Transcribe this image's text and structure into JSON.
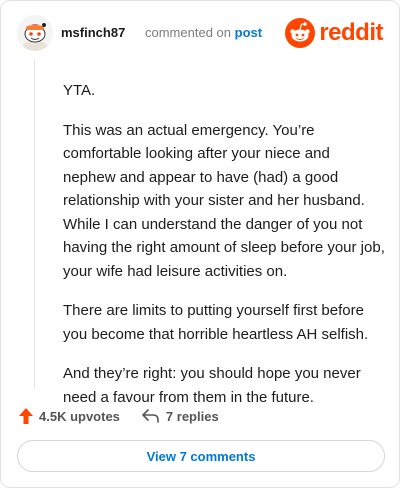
{
  "header": {
    "username": "msfinch87",
    "commented_on": "commented on",
    "post_link": "post",
    "logo_wordmark": "reddit",
    "brand_color": "#ff4500",
    "avatar_icon": "snoo-avatar-icon"
  },
  "comment": {
    "paragraphs": [
      "YTA.",
      "This was an actual emergency. You’re comfortable looking after your niece and nephew and appear to have (had) a good relationship with your sister and her husband. While I can understand the danger of you not having the right amount of sleep before your job, your wife had leisure activities on.",
      "There are limits to putting yourself first before you become that horrible heartless AH selfish.",
      "And they’re right: you should hope you never need a favour from them in the future."
    ]
  },
  "actions": {
    "upvotes": "4.5K upvotes",
    "replies": "7 replies",
    "upvote_icon": "upvote-arrow-icon",
    "reply_icon": "reply-arrow-icon",
    "upvote_color": "#ff4500"
  },
  "footer": {
    "view_comments_label": "View 7 comments",
    "link_color": "#0079d3"
  }
}
